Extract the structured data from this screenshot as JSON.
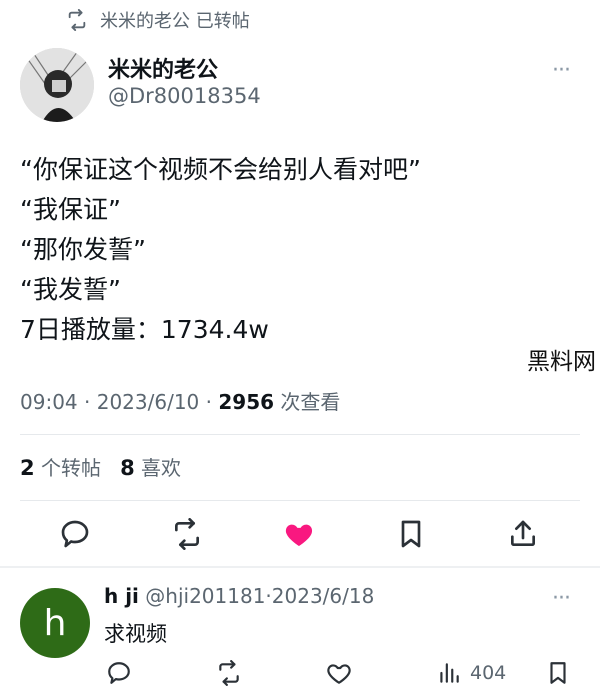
{
  "retweet_banner": {
    "text": "米米的老公 已转帖",
    "icon": "retweet-icon"
  },
  "author": {
    "name": "米米的老公",
    "handle": "@Dr80018354"
  },
  "tweet": {
    "lines": [
      "“你保证这个视频不会给别人看对吧”",
      "“我保证”",
      "“那你发誓”",
      "“我发誓”",
      "7日播放量：1734.4w"
    ]
  },
  "watermark": "黑料网",
  "meta": {
    "time": "09:04",
    "sep": "·",
    "date": "2023/6/10",
    "views": "2956",
    "views_label": "次查看"
  },
  "stats": {
    "reposts": "2",
    "reposts_label": "个转帖",
    "likes": "8",
    "likes_label": "喜欢"
  },
  "actions": [
    "reply-icon",
    "retweet-icon",
    "heart-icon",
    "bookmark-icon",
    "share-icon"
  ],
  "colors": {
    "like_active": "#f91880",
    "reply_avatar": "#2e6b17",
    "muted": "#5b6670"
  },
  "reply": {
    "avatar_letter": "h",
    "name": "h ji",
    "handle": "@hji201181",
    "sep": "·",
    "date": "2023/6/18",
    "text": "求视频",
    "views": "404"
  },
  "more_label": "···"
}
